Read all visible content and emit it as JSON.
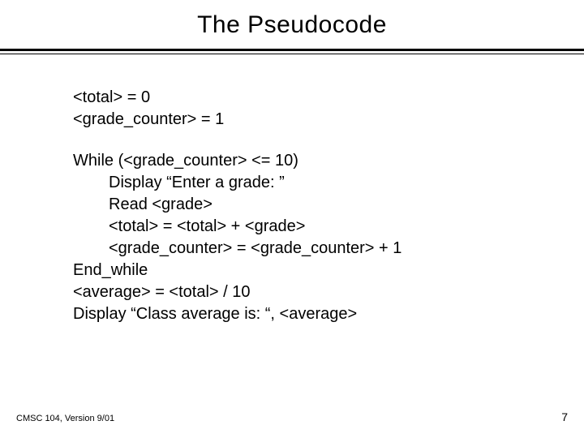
{
  "title": "The Pseudocode",
  "init": {
    "line1": "<total> = 0",
    "line2": "<grade_counter> = 1"
  },
  "loop": {
    "while": "While  (<grade_counter> <= 10)",
    "body1": "Display “Enter a grade: ”",
    "body2": "Read <grade>",
    "body3": "<total> = <total> + <grade>",
    "body4": "<grade_counter> = <grade_counter> + 1",
    "end": "End_while",
    "avg": "<average> = <total> / 10",
    "display": "Display “Class average is: “, <average>"
  },
  "footer": {
    "left": "CMSC 104, Version 9/01",
    "right": "7"
  }
}
